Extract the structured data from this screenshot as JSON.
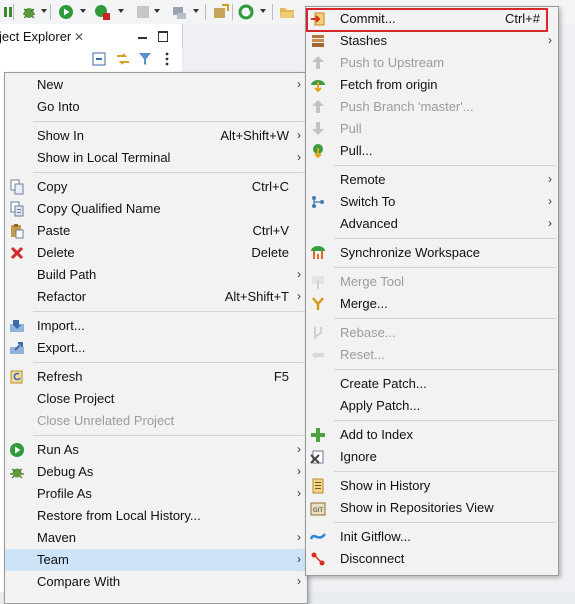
{
  "colors": {
    "accent": "#cde3f7",
    "highlight": "#d6262b",
    "menu_bg": "#f2f2f2"
  },
  "view": {
    "title": "ject Explorer"
  },
  "left_menu": {
    "items": [
      {
        "name": "new",
        "label": "New",
        "submenu": true,
        "icon": "none"
      },
      {
        "name": "go-into",
        "label": "Go Into",
        "icon": "none"
      },
      {
        "name": "show-in",
        "label": "Show In",
        "shortcut": "Alt+Shift+W",
        "submenu": true,
        "icon": "none"
      },
      {
        "name": "show-in-local-terminal",
        "label": "Show in Local Terminal",
        "submenu": true,
        "icon": "none"
      },
      {
        "name": "copy",
        "label": "Copy",
        "shortcut": "Ctrl+C",
        "icon": "copy-icon"
      },
      {
        "name": "copy-qualified-name",
        "label": "Copy Qualified Name",
        "icon": "copy-qualified-icon"
      },
      {
        "name": "paste",
        "label": "Paste",
        "shortcut": "Ctrl+V",
        "icon": "paste-icon"
      },
      {
        "name": "delete",
        "label": "Delete",
        "shortcut": "Delete",
        "icon": "delete-icon"
      },
      {
        "name": "build-path",
        "label": "Build Path",
        "submenu": true,
        "icon": "none"
      },
      {
        "name": "refactor",
        "label": "Refactor",
        "shortcut": "Alt+Shift+T",
        "submenu": true,
        "icon": "none"
      },
      {
        "name": "import",
        "label": "Import...",
        "icon": "import-icon"
      },
      {
        "name": "export",
        "label": "Export...",
        "icon": "export-icon"
      },
      {
        "name": "refresh",
        "label": "Refresh",
        "shortcut": "F5",
        "icon": "refresh-icon"
      },
      {
        "name": "close-project",
        "label": "Close Project",
        "icon": "none"
      },
      {
        "name": "close-unrelated-project",
        "label": "Close Unrelated Project",
        "disabled": true,
        "icon": "none"
      },
      {
        "name": "run-as",
        "label": "Run As",
        "submenu": true,
        "icon": "run-icon"
      },
      {
        "name": "debug-as",
        "label": "Debug As",
        "submenu": true,
        "icon": "debug-icon"
      },
      {
        "name": "profile-as",
        "label": "Profile As",
        "submenu": true,
        "icon": "none"
      },
      {
        "name": "restore-from-local-history",
        "label": "Restore from Local History...",
        "icon": "none"
      },
      {
        "name": "maven",
        "label": "Maven",
        "submenu": true,
        "icon": "none"
      },
      {
        "name": "team",
        "label": "Team",
        "submenu": true,
        "selected": true,
        "icon": "none"
      },
      {
        "name": "compare-with",
        "label": "Compare With",
        "submenu": true,
        "icon": "none"
      }
    ]
  },
  "right_menu": {
    "items": [
      {
        "name": "commit",
        "label": "Commit...",
        "shortcut": "Ctrl+#",
        "icon": "commit-icon",
        "highlighted": true
      },
      {
        "name": "stashes",
        "label": "Stashes",
        "submenu": true,
        "icon": "stash-icon"
      },
      {
        "name": "push-to-upstream",
        "label": "Push to Upstream",
        "disabled": true,
        "icon": "push-icon"
      },
      {
        "name": "fetch-from-origin",
        "label": "Fetch from origin",
        "icon": "fetch-icon"
      },
      {
        "name": "push-branch",
        "label": "Push Branch 'master'...",
        "disabled": true,
        "icon": "push-branch-icon"
      },
      {
        "name": "pull",
        "label": "Pull",
        "disabled": true,
        "icon": "pull-icon"
      },
      {
        "name": "pull-dialog",
        "label": "Pull...",
        "icon": "pull-dialog-icon"
      },
      {
        "name": "remote",
        "label": "Remote",
        "submenu": true,
        "icon": "none"
      },
      {
        "name": "switch-to",
        "label": "Switch To",
        "submenu": true,
        "icon": "branch-icon"
      },
      {
        "name": "advanced",
        "label": "Advanced",
        "submenu": true,
        "icon": "none"
      },
      {
        "name": "synchronize-workspace",
        "label": "Synchronize Workspace",
        "icon": "sync-icon"
      },
      {
        "name": "merge-tool",
        "label": "Merge Tool",
        "disabled": true,
        "icon": "merge-tool-icon"
      },
      {
        "name": "merge",
        "label": "Merge...",
        "icon": "merge-icon"
      },
      {
        "name": "rebase",
        "label": "Rebase...",
        "disabled": true,
        "icon": "rebase-icon"
      },
      {
        "name": "reset",
        "label": "Reset...",
        "disabled": true,
        "icon": "reset-icon"
      },
      {
        "name": "create-patch",
        "label": "Create Patch...",
        "icon": "none"
      },
      {
        "name": "apply-patch",
        "label": "Apply Patch...",
        "icon": "none"
      },
      {
        "name": "add-to-index",
        "label": "Add to Index",
        "icon": "add-index-icon"
      },
      {
        "name": "ignore",
        "label": "Ignore",
        "icon": "ignore-icon"
      },
      {
        "name": "show-in-history",
        "label": "Show in History",
        "icon": "history-icon"
      },
      {
        "name": "show-in-repositories-view",
        "label": "Show in Repositories View",
        "icon": "git-repo-icon"
      },
      {
        "name": "init-gitflow",
        "label": "Init Gitflow...",
        "icon": "gitflow-icon"
      },
      {
        "name": "disconnect",
        "label": "Disconnect",
        "icon": "disconnect-icon"
      }
    ]
  }
}
